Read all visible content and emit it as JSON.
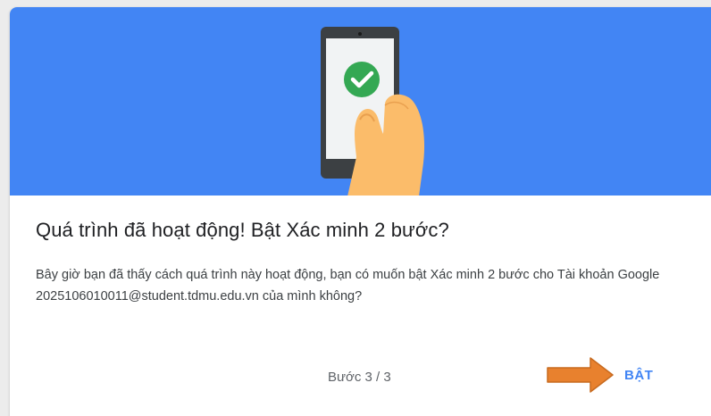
{
  "dialog": {
    "title": "Quá trình đã hoạt động! Bật Xác minh 2 bước?",
    "description": "Bây giờ bạn đã thấy cách quá trình này hoạt động, bạn có muốn bật Xác minh 2 bước cho Tài khoản Google 2025106010011@student.tdmu.edu.vn của mình không?",
    "step_label": "Bước 3 / 3",
    "turn_on_label": "BẬT"
  },
  "colors": {
    "hero_background": "#4285f4",
    "accent": "#4285f4",
    "check_circle": "#34a853",
    "annotation_arrow": "#e8812e"
  },
  "icons": {
    "hero": "hand-holding-phone-illustration",
    "check": "check-circle-icon",
    "annotation": "right-arrow-annotation"
  }
}
